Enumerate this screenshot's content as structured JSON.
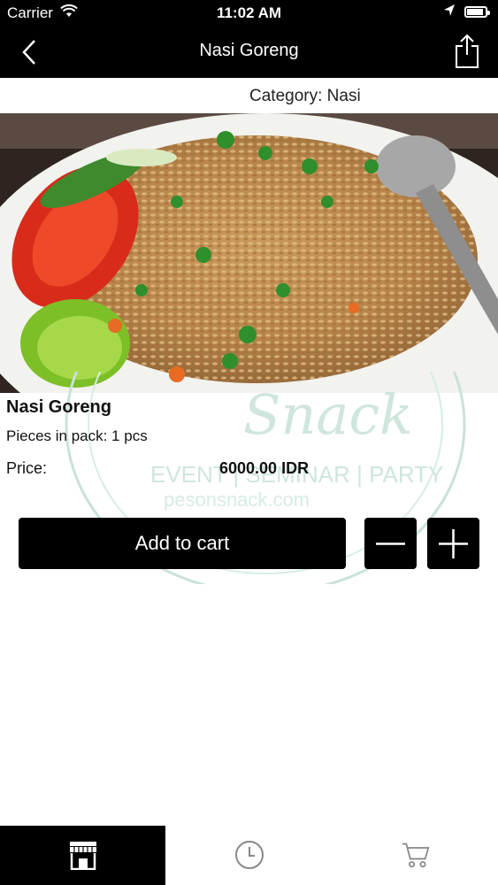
{
  "status": {
    "carrier": "Carrier",
    "time": "11:02 AM"
  },
  "nav": {
    "title": "Nasi Goreng"
  },
  "category": {
    "text": "Category: Nasi"
  },
  "product": {
    "name": "Nasi Goreng",
    "pieces": "Pieces in pack: 1 pcs",
    "price_label": "Price:",
    "price_value": "6000.00 IDR"
  },
  "actions": {
    "add_to_cart": "Add to cart"
  },
  "watermark": {
    "brand": "Snack",
    "tagline": "EVENT | SEMINAR | PARTY",
    "site": "pesonsnack.com"
  },
  "tabs": [
    {
      "name": "store",
      "active": true
    },
    {
      "name": "history",
      "active": false
    },
    {
      "name": "cart",
      "active": false
    }
  ]
}
